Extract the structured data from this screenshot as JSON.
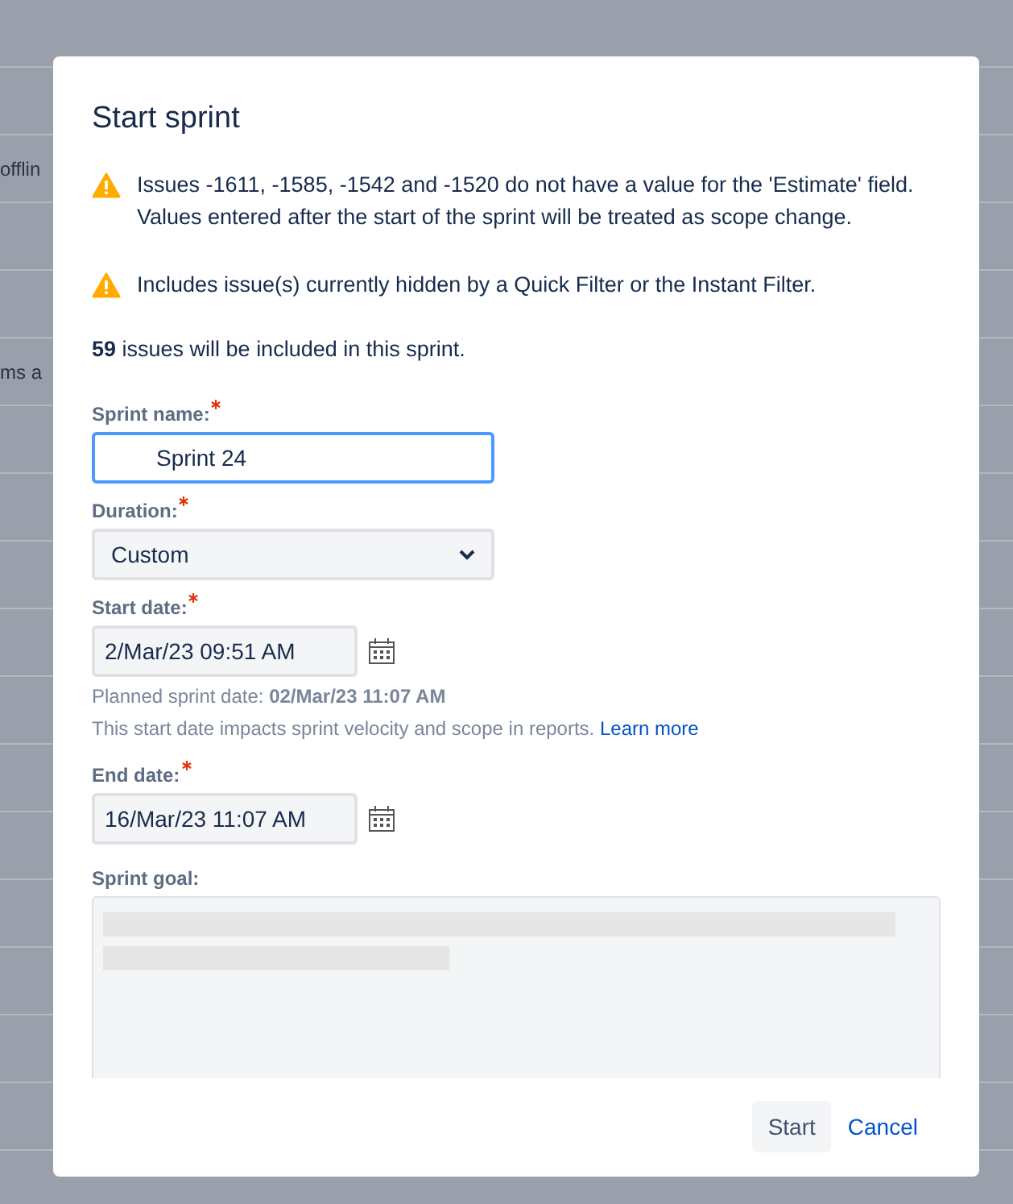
{
  "background": {
    "row_texts": [
      {
        "text": "offlin"
      },
      {
        "text": "ms a"
      }
    ]
  },
  "dialog": {
    "title": "Start sprint",
    "warnings": [
      {
        "text": "Issues -1611, -1585, -1542 and -1520 do not have a value for the 'Estimate' field. Values entered after the start of the sprint will be treated as scope change."
      },
      {
        "text": "Includes issue(s) currently hidden by a Quick Filter or the Instant Filter."
      }
    ],
    "summary": "**59** issues will be included in this sprint.",
    "fields": [
      {
        "kind": "text",
        "label": "Sprint name:",
        "required": true,
        "value": "Sprint 24",
        "focused": true
      },
      {
        "kind": "select",
        "label": "Duration:",
        "required": true,
        "value": "Custom"
      },
      {
        "kind": "date",
        "label": "Start date:",
        "required": true,
        "value": "2/Mar/23 09:51 AM",
        "help": "Planned sprint date: **02/Mar/23 11:07 AM**",
        "note": "This start date impacts sprint velocity and scope in reports.",
        "link": "Learn more"
      },
      {
        "kind": "date",
        "label": "End date:",
        "required": true,
        "value": "16/Mar/23 11:07 AM"
      },
      {
        "kind": "textarea",
        "label": "Sprint goal:",
        "required": false
      }
    ],
    "buttons": [
      {
        "label": "Start",
        "kind": "button"
      },
      {
        "label": "Cancel",
        "kind": "link"
      }
    ]
  }
}
